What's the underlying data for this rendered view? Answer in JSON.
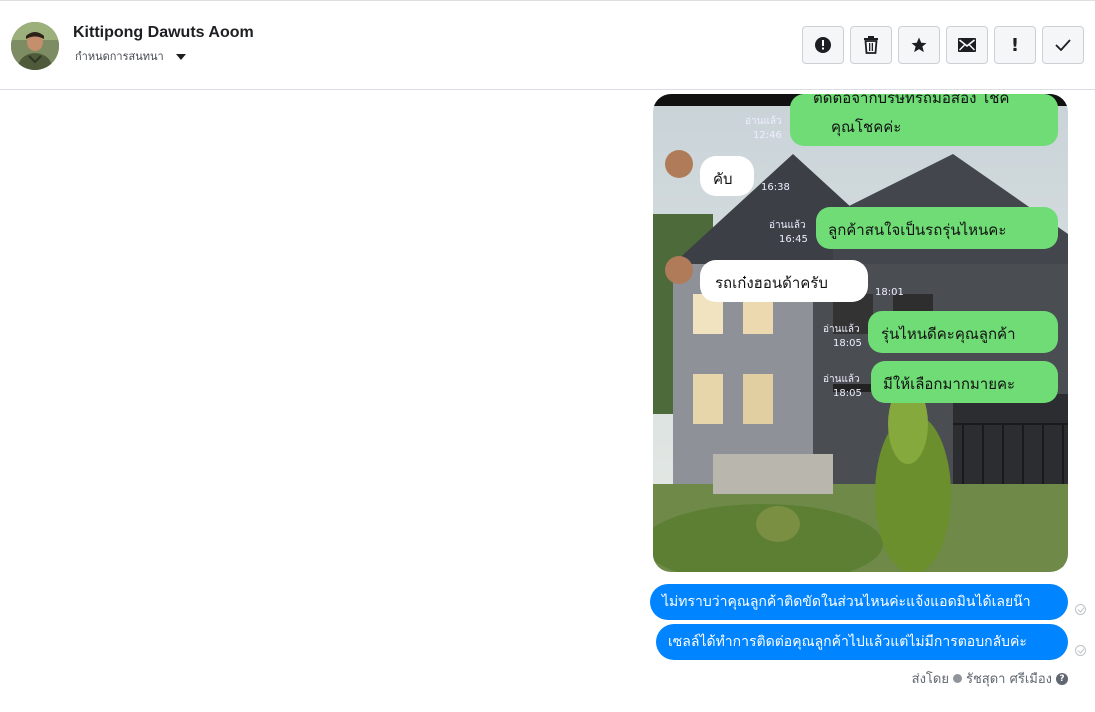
{
  "header": {
    "contact_name": "Kittipong Dawuts Aoom",
    "subtitle": "กำหนดการสนทนา",
    "actions": [
      {
        "name": "spam",
        "icon": "alert-circle-icon"
      },
      {
        "name": "delete",
        "icon": "trash-icon"
      },
      {
        "name": "star",
        "icon": "star-icon"
      },
      {
        "name": "mark-unread",
        "icon": "envelope-icon"
      },
      {
        "name": "priority",
        "icon": "exclamation-icon"
      },
      {
        "name": "done",
        "icon": "checkmark-icon"
      }
    ]
  },
  "photo": {
    "chat_lines": [
      {
        "side": "right",
        "text": "ติดต่อจากบริษัทรถมือสอง โชค",
        "meta": "อ่านแล้ว"
      },
      {
        "side": "right",
        "text": "คุณโชคค่ะ",
        "meta": "12:46"
      },
      {
        "side": "left",
        "text": "คับ",
        "meta": "16:38"
      },
      {
        "side": "right",
        "text": "ลูกค้าสนใจเป็นรถรุ่นไหนคะ",
        "meta": "อ่านแล้ว",
        "time": "16:45"
      },
      {
        "side": "left",
        "text": "รถเก๋งฮอนด้าครับ",
        "meta": "18:01"
      },
      {
        "side": "right",
        "text": "รุ่นไหนดีคะคุณลูกค้า",
        "meta": "อ่านแล้ว",
        "time": "18:05"
      },
      {
        "side": "right",
        "text": "มีให้เลือกมากมายคะ",
        "meta": "อ่านแล้ว",
        "time": "18:05"
      }
    ]
  },
  "messages": [
    {
      "text": "ไม่ทราบว่าคุณลูกค้าติดขัดในส่วนไหนค่ะแจ้งแอดมินได้เลยน๊า"
    },
    {
      "text": "เซลล์ได้ทำการติดต่อคุณลูกค้าไปแล้วแต่ไม่มีการตอบกลับค่ะ"
    }
  ],
  "sent_by": {
    "prefix": "ส่งโดย",
    "name": "รัชสุดา ศรีเมือง",
    "help": "?"
  },
  "colors": {
    "bubble_blue": "#0084ff",
    "line_green": "#6fdc76"
  }
}
